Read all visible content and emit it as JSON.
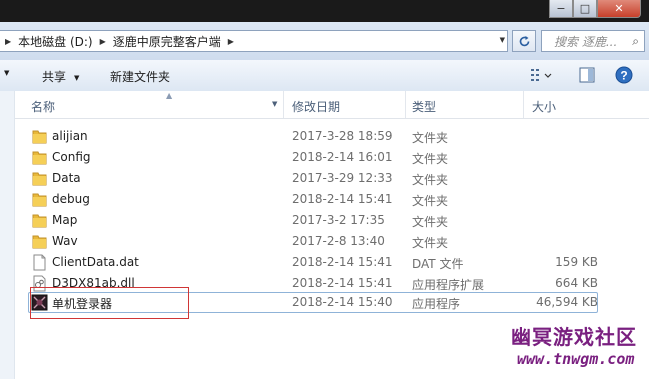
{
  "window": {
    "min_glyph": "−",
    "max_glyph": "□",
    "close_glyph": "✕"
  },
  "address": {
    "crumbs": [
      "本地磁盘 (D:)",
      "逐鹿中原完整客户端"
    ],
    "sep_glyph": "▶"
  },
  "search": {
    "placeholder": "搜索 逐鹿...",
    "icon": "search-icon"
  },
  "toolbar": {
    "share_label": "共享",
    "new_folder_label": "新建文件夹"
  },
  "columns": {
    "name": "名称",
    "date": "修改日期",
    "type": "类型",
    "size": "大小"
  },
  "files": [
    {
      "name": "alijian",
      "date": "2017-3-28 18:59",
      "type": "文件夹",
      "size": "",
      "icon": "folder-icon"
    },
    {
      "name": "Config",
      "date": "2018-2-14 16:01",
      "type": "文件夹",
      "size": "",
      "icon": "folder-icon"
    },
    {
      "name": "Data",
      "date": "2017-3-29 12:33",
      "type": "文件夹",
      "size": "",
      "icon": "folder-icon"
    },
    {
      "name": "debug",
      "date": "2018-2-14 15:41",
      "type": "文件夹",
      "size": "",
      "icon": "folder-icon"
    },
    {
      "name": "Map",
      "date": "2017-3-2 17:35",
      "type": "文件夹",
      "size": "",
      "icon": "folder-icon"
    },
    {
      "name": "Wav",
      "date": "2017-2-8 13:40",
      "type": "文件夹",
      "size": "",
      "icon": "folder-icon"
    },
    {
      "name": "ClientData.dat",
      "date": "2018-2-14 15:41",
      "type": "DAT 文件",
      "size": "159 KB",
      "icon": "file-icon"
    },
    {
      "name": "D3DX81ab.dll",
      "date": "2018-2-14 15:41",
      "type": "应用程序扩展",
      "size": "664 KB",
      "icon": "dll-icon"
    },
    {
      "name": "单机登录器",
      "date": "2018-2-14 15:40",
      "type": "应用程序",
      "size": "46,594 KB",
      "icon": "exe-icon"
    }
  ],
  "watermark": {
    "line1": "幽冥游戏社区",
    "line2": "www.tnwgm.com"
  },
  "colors": {
    "folder": "#e8b83a",
    "highlight_box": "#d03636",
    "watermark": "#7a2080"
  }
}
